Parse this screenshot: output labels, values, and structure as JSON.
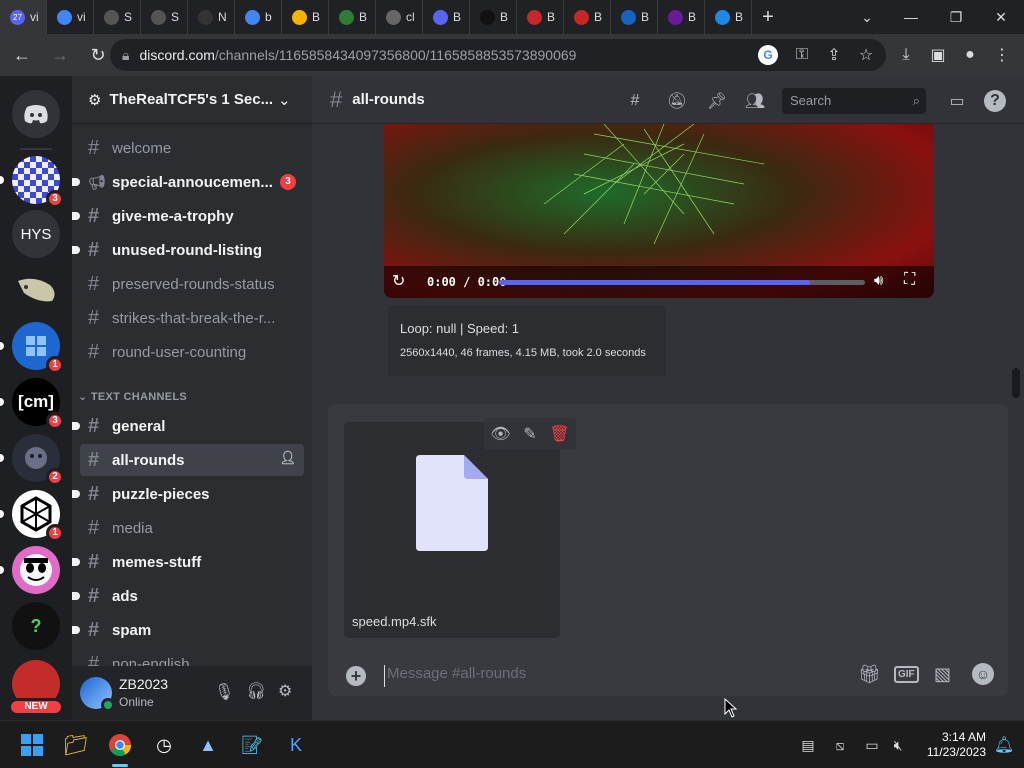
{
  "browser": {
    "tabs": [
      {
        "label": "vi",
        "badge": "27"
      },
      {
        "label": "vi"
      },
      {
        "label": "S"
      },
      {
        "label": "S"
      },
      {
        "label": "N"
      },
      {
        "label": "b"
      },
      {
        "label": "B"
      },
      {
        "label": "B"
      },
      {
        "label": "cl"
      },
      {
        "label": "B"
      },
      {
        "label": "B"
      },
      {
        "label": "B"
      },
      {
        "label": "B"
      },
      {
        "label": "B"
      },
      {
        "label": "B"
      },
      {
        "label": "B"
      }
    ],
    "new_tab_label": "+",
    "url_host": "discord.com",
    "url_path": "/channels/1165858434097356800/1165858853573890069"
  },
  "rail": {
    "servers": [
      {
        "name": "home",
        "label": "",
        "badge": ""
      },
      {
        "name": "server-checkers",
        "label": "",
        "badge": "3"
      },
      {
        "name": "server-hys",
        "label": "HYS",
        "badge": ""
      },
      {
        "name": "server-fish",
        "label": "",
        "badge": ""
      },
      {
        "name": "server-blue",
        "label": "",
        "badge": "1"
      },
      {
        "name": "server-cm",
        "label": "[cm]",
        "badge": "3"
      },
      {
        "name": "server-dark",
        "label": "",
        "badge": "2"
      },
      {
        "name": "server-hex",
        "label": "",
        "badge": "1"
      },
      {
        "name": "server-face",
        "label": "",
        "badge": ""
      },
      {
        "name": "server-question",
        "label": "?",
        "badge": ""
      },
      {
        "name": "server-new",
        "label": "NEW",
        "badge": ""
      }
    ]
  },
  "guild": {
    "name": "TheRealTCF5's 1 Sec...",
    "channels_top": [
      {
        "name": "welcome",
        "state": "muted"
      },
      {
        "name": "special-annoucemen...",
        "state": "unread",
        "badge": "3",
        "type": "announcement"
      },
      {
        "name": "give-me-a-trophy",
        "state": "unread"
      },
      {
        "name": "unused-round-listing",
        "state": "unread"
      },
      {
        "name": "preserved-rounds-status",
        "state": "muted"
      },
      {
        "name": "strikes-that-break-the-r...",
        "state": "muted"
      },
      {
        "name": "round-user-counting",
        "state": "muted"
      }
    ],
    "category": "TEXT CHANNELS",
    "channels_text": [
      {
        "name": "general",
        "state": "unread"
      },
      {
        "name": "all-rounds",
        "state": "selected"
      },
      {
        "name": "puzzle-pieces",
        "state": "unread"
      },
      {
        "name": "media",
        "state": "muted"
      },
      {
        "name": "memes-stuff",
        "state": "unread"
      },
      {
        "name": "ads",
        "state": "unread"
      },
      {
        "name": "spam",
        "state": "unread"
      },
      {
        "name": "non-english",
        "state": "muted"
      }
    ]
  },
  "user": {
    "name": "ZB2023",
    "status": "Online"
  },
  "header": {
    "channel": "all-rounds",
    "search_placeholder": "Search"
  },
  "video": {
    "time": "0:00 / 0:00",
    "progress": 0.85
  },
  "embed": {
    "line1": "Loop: null | Speed: 1",
    "line2": "2560x1440, 46 frames, 4.15 MB, took 2.0 seconds"
  },
  "attachment": {
    "filename": "speed.mp4.sfk"
  },
  "composer": {
    "placeholder": "Message #all-rounds",
    "gif_label": "GIF"
  },
  "taskbar": {
    "time": "3:14 AM",
    "date": "11/23/2023"
  },
  "colors": {
    "blurple": "#5865f2",
    "danger": "#f23f43",
    "online": "#23a55a"
  }
}
